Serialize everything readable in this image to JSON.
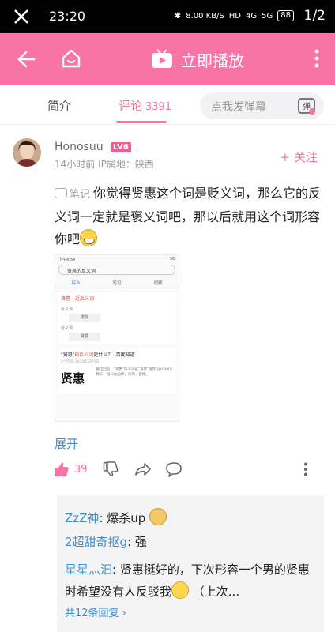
{
  "status_bar": {
    "time": "23:20",
    "speed": "8.00 KB/S",
    "hd": "HD",
    "net1": "4G",
    "net2": "5G",
    "battery": "88",
    "page_indicator": "1/2"
  },
  "header": {
    "title": "立即播放"
  },
  "tabs": {
    "intro": "简介",
    "comments": "评论",
    "comments_count": "3391",
    "danmaku_placeholder": "点我发弹幕",
    "danmaku_button": "弹"
  },
  "comment": {
    "username": "Honosuu",
    "level": "LV6",
    "time": "14小时前",
    "ip": "IP属地：陕西",
    "follow": "+ 关注",
    "note_tag": "笔记",
    "text": "你觉得贤惠这个词是贬义词，那么它的反义词一定就是褒义词吧，那以后就用这个词形容你吧",
    "expand": "展开",
    "likes": "39"
  },
  "embedded_image": {
    "status_left": "上午8:54",
    "status_right": "5G",
    "search_text": "贤惠的反义词",
    "tabs": [
      "综合",
      "笔记",
      "视频"
    ],
    "card_title": "贤惠 - 近反义词",
    "label_antonym": "反义词",
    "antonym": "泼悍",
    "label_synonym": "近义词",
    "synonym": "贤慧",
    "q_title_pre": "\"贤惠\"",
    "q_title_red": "的反义词",
    "q_title_post": "是什么？- 百度知道",
    "q_sub": "2个回答  2019年5月5日",
    "big_chars": "贤惠",
    "q_desc": "最佳回答：\"贤惠\"反义词是\"泼悍\"泼悍 [pō hàn] 释义：指妇女凶悍，泼辣，蛮横。"
  },
  "replies": [
    {
      "user": "ZzZ神",
      "sep": ": ",
      "text": "爆杀up"
    },
    {
      "user": "2超甜奇抠g",
      "sep": ": ",
      "text": "强"
    },
    {
      "user": "星星灬汩",
      "sep": ": ",
      "text": "贤惠挺好的，下次形容一个男的贤惠时希望没有人反驳我",
      "tail": " （上次..."
    }
  ],
  "more_replies": "共12条回复 ›",
  "colors": {
    "brand_pink": "#f774a4",
    "link_blue": "#3d8fd1"
  }
}
